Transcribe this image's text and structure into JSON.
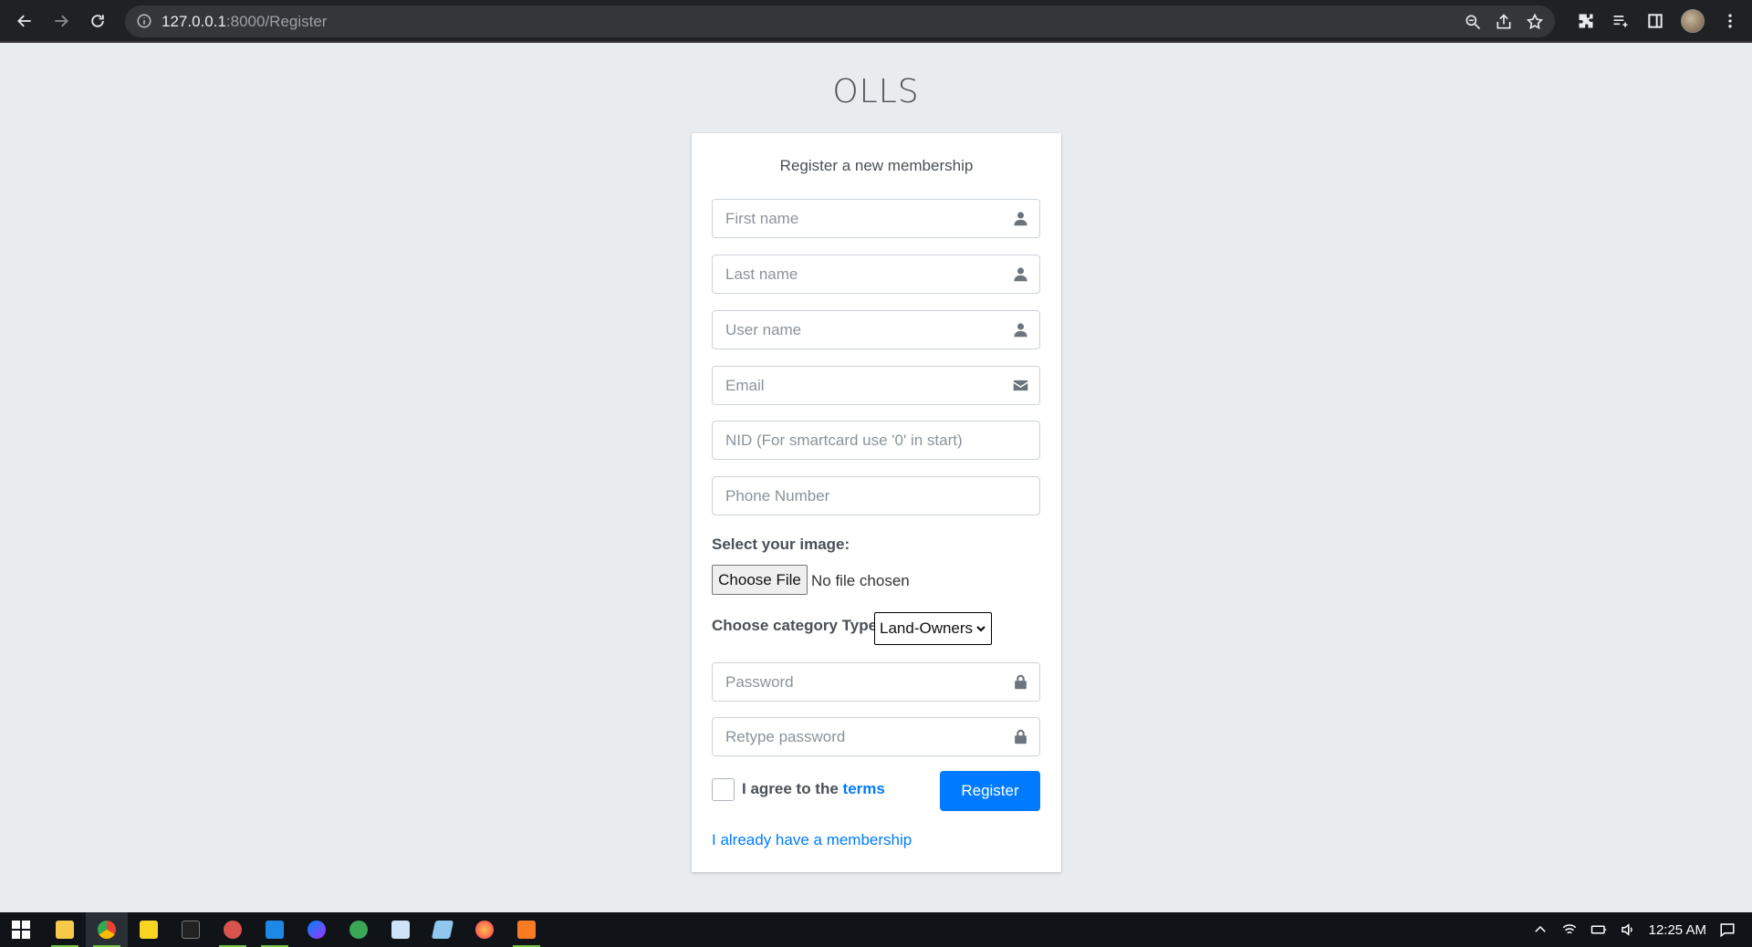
{
  "browser": {
    "url_host": "127.0.0.1",
    "url_path": ":8000/Register"
  },
  "page": {
    "brand": "OLLS",
    "card_message": "Register a new membership",
    "fields": {
      "first_name_placeholder": "First name",
      "last_name_placeholder": "Last name",
      "user_name_placeholder": "User name",
      "email_placeholder": "Email",
      "nid_placeholder": "NID (For smartcard use '0' in start)",
      "phone_placeholder": "Phone Number",
      "password_placeholder": "Password",
      "retype_password_placeholder": "Retype password"
    },
    "image_label": "Select your image:",
    "choose_file_label": "Choose File",
    "file_status": "No file chosen",
    "category_label": "Choose category Type:",
    "category_selected": "Land-Owners",
    "agree_text": "I agree to the",
    "terms_link": "terms",
    "register_button": "Register",
    "membership_link": "I already have a membership"
  },
  "taskbar": {
    "time": "12:25 AM",
    "apps": [
      "file-explorer",
      "chrome",
      "sticky-notes",
      "terminal",
      "app-5",
      "vscode",
      "messenger",
      "app-8",
      "notepad",
      "app-10",
      "firefox",
      "xampp"
    ]
  },
  "colors": {
    "primary": "#007bff",
    "page_bg": "#e9ecef",
    "chrome_bg": "#202124",
    "taskbar_bg": "#101418"
  }
}
